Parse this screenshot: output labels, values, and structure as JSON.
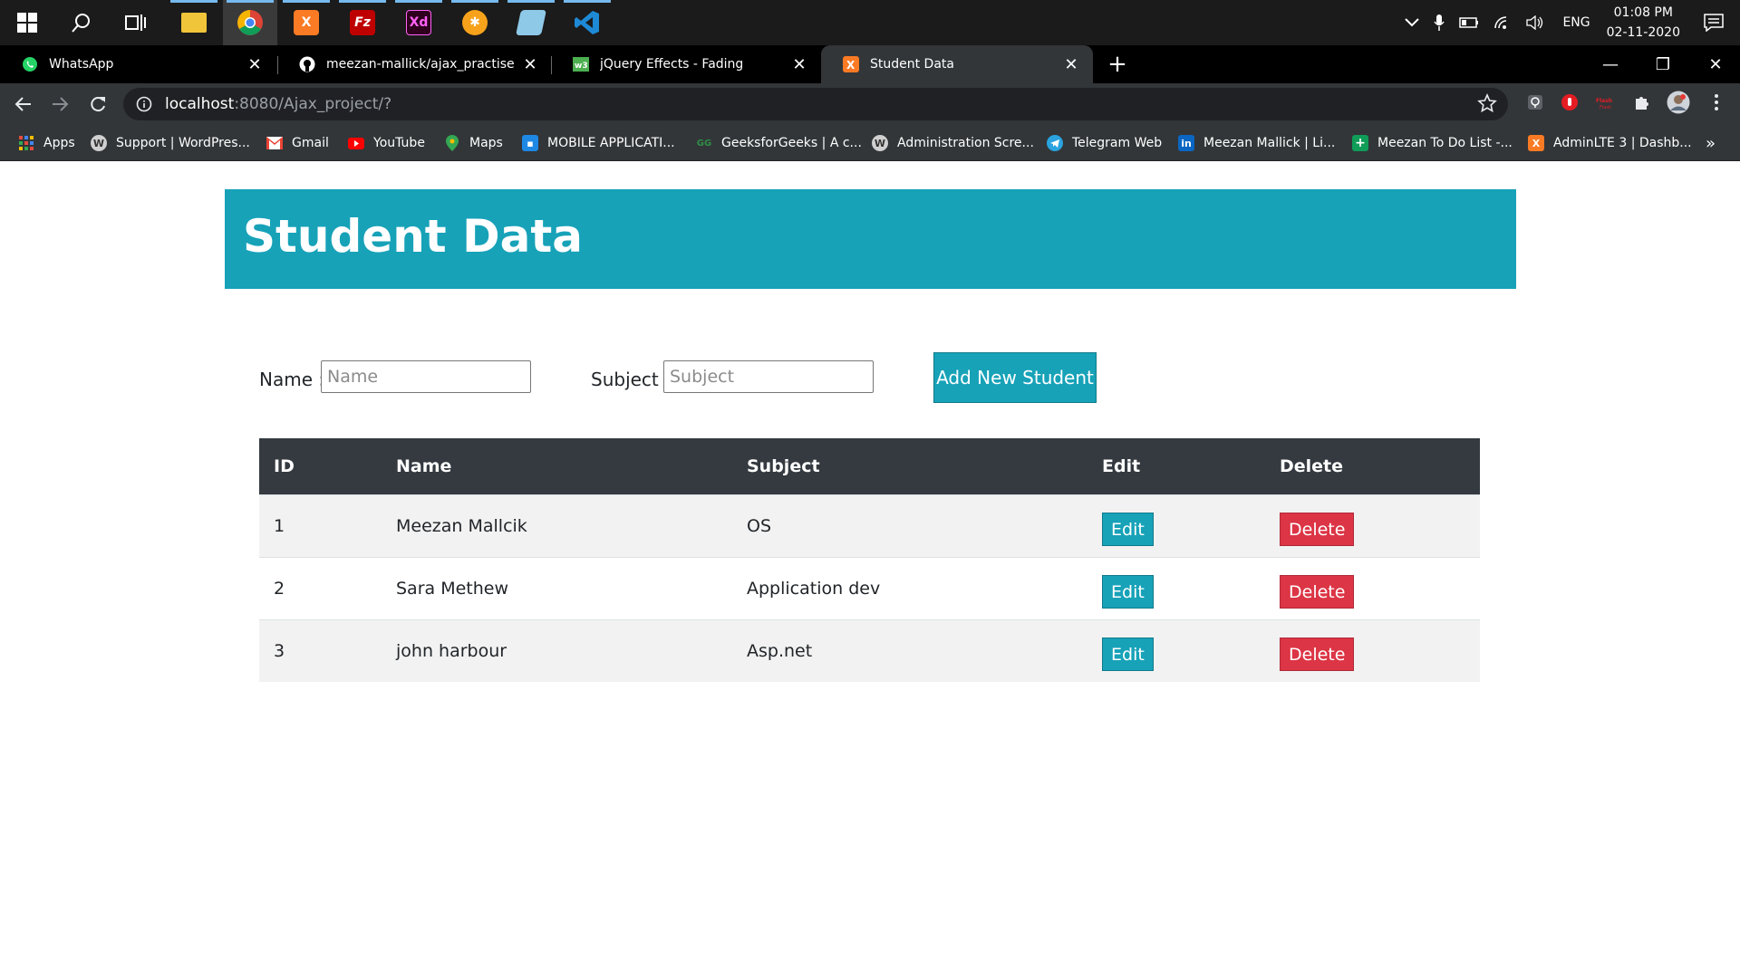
{
  "taskbar": {
    "apps": [
      {
        "name": "File Explorer",
        "icon": "folder-icon"
      },
      {
        "name": "Google Chrome",
        "icon": "chrome-icon"
      },
      {
        "name": "XAMPP",
        "icon": "xampp-icon"
      },
      {
        "name": "FileZilla",
        "icon": "filezilla-icon"
      },
      {
        "name": "Adobe XD",
        "icon": "xd-icon"
      },
      {
        "name": "App",
        "icon": "orange-app-icon"
      },
      {
        "name": "App",
        "icon": "blue-app-icon"
      },
      {
        "name": "Visual Studio Code",
        "icon": "vscode-icon"
      }
    ],
    "language": "ENG",
    "time": "01:08 PM",
    "date": "02-11-2020"
  },
  "browser": {
    "tabs": [
      {
        "title": "WhatsApp",
        "icon": "whatsapp-icon",
        "active": false
      },
      {
        "title": "meezan-mallick/ajax_practise: pr",
        "icon": "github-icon",
        "active": false
      },
      {
        "title": "jQuery Effects - Fading",
        "icon": "w3schools-icon",
        "active": false
      },
      {
        "title": "Student Data",
        "icon": "xampp-icon",
        "active": true
      }
    ],
    "url_host": "localhost",
    "url_path": ":8080/Ajax_project/?",
    "bookmarks": [
      {
        "label": "Apps",
        "icon": "apps-grid-icon",
        "color": "#4285f4"
      },
      {
        "label": "Support | WordPres...",
        "icon": "wordpress-icon",
        "color": "#d0d0d0"
      },
      {
        "label": "Gmail",
        "icon": "gmail-icon",
        "color": "#ea4335"
      },
      {
        "label": "YouTube",
        "icon": "youtube-icon",
        "color": "#ff0000"
      },
      {
        "label": "Maps",
        "icon": "maps-icon",
        "color": "#34a853"
      },
      {
        "label": "MOBILE APPLICATI...",
        "icon": "classroom-icon",
        "color": "#1e88e5"
      },
      {
        "label": "GeeksforGeeks | A c...",
        "icon": "geeksforgeeks-icon",
        "color": "#2f8d46"
      },
      {
        "label": "Administration Scre...",
        "icon": "wordpress-icon",
        "color": "#d0d0d0"
      },
      {
        "label": "Telegram Web",
        "icon": "telegram-icon",
        "color": "#2aa3df"
      },
      {
        "label": "Meezan Mallick | Li...",
        "icon": "linkedin-icon",
        "color": "#0a66c2"
      },
      {
        "label": "Meezan To Do List -...",
        "icon": "sheets-icon",
        "color": "#0f9d58"
      },
      {
        "label": "AdminLTE 3 | Dashb...",
        "icon": "xampp-icon",
        "color": "#fb7a24"
      }
    ],
    "bookmarks_overflow": "»"
  },
  "page": {
    "title": "Student Data",
    "form": {
      "name_label": "Name :",
      "name_placeholder": "Name",
      "subject_label": "Subject :",
      "subject_placeholder": "Subject",
      "add_button": "Add New Student"
    },
    "table": {
      "headers": [
        "ID",
        "Name",
        "Subject",
        "Edit",
        "Delete"
      ],
      "rows": [
        {
          "id": "1",
          "name": "Meezan Mallcik",
          "subject": "OS",
          "edit": "Edit",
          "delete": "Delete"
        },
        {
          "id": "2",
          "name": "Sara Methew",
          "subject": "Application dev",
          "edit": "Edit",
          "delete": "Delete"
        },
        {
          "id": "3",
          "name": "john harbour",
          "subject": "Asp.net",
          "edit": "Edit",
          "delete": "Delete"
        }
      ]
    }
  },
  "colors": {
    "header_bg": "#17a2b8",
    "table_head_bg": "#343a40",
    "edit_button": "#17a2b8",
    "delete_button": "#dc3545"
  }
}
